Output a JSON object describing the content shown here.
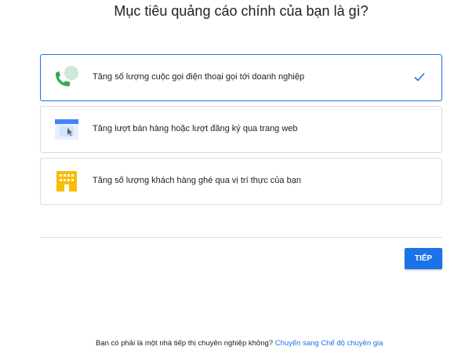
{
  "header": {
    "title": "Mục tiêu quảng cáo chính của bạn là gì?"
  },
  "options": [
    {
      "label": "Tăng số lượng cuộc gọi điện thoại gọi tới doanh nghiệp",
      "icon": "phone-call-icon",
      "selected": true
    },
    {
      "label": "Tăng lượt bán hàng hoặc lượt đăng ký qua trang web",
      "icon": "browser-window-icon",
      "selected": false
    },
    {
      "label": "Tăng số lượng khách hàng ghé qua vị trí thực của bạn",
      "icon": "storefront-building-icon",
      "selected": false
    }
  ],
  "next_button": {
    "label": "TIẾP"
  },
  "footer": {
    "question": "Bạn có phải là một nhà tiếp thị chuyên nghiệp không?",
    "link": "Chuyển sang Chế độ chuyên gia"
  },
  "colors": {
    "accent": "#1a73e8",
    "phone_green": "#34a853",
    "phone_bubble": "#ceead6",
    "browser_blue": "#4285f4",
    "browser_light": "#d2e3fc",
    "building_yellow": "#fbbc04"
  }
}
